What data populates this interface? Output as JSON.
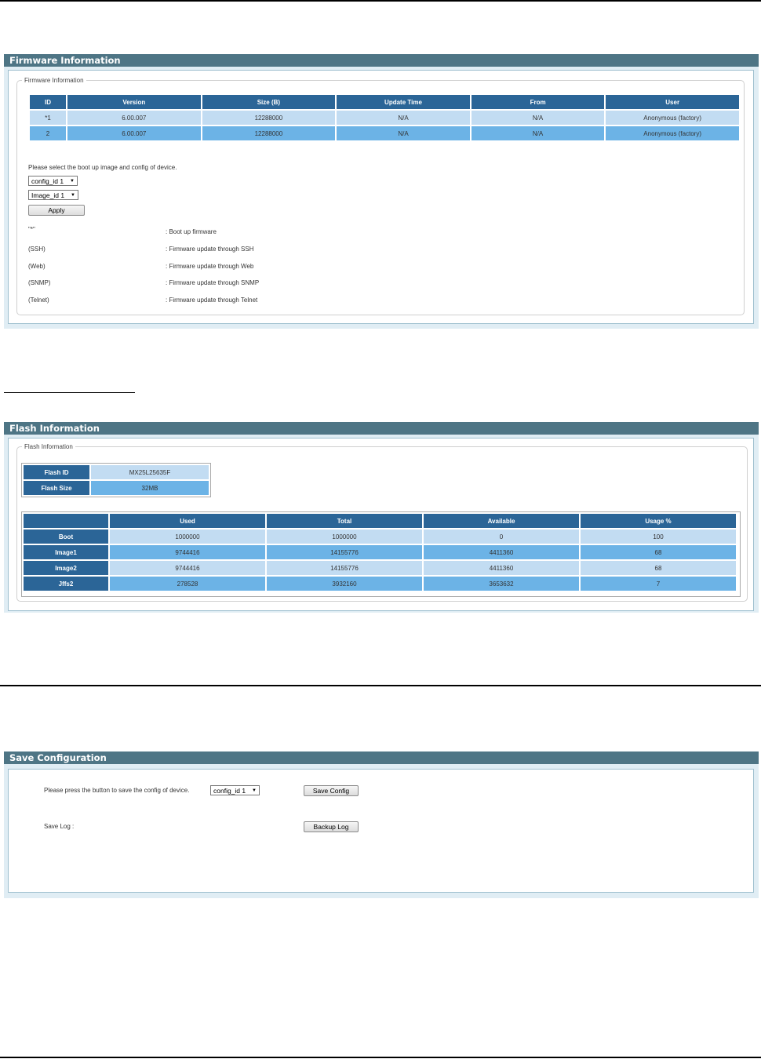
{
  "firmware": {
    "panel_title": "Firmware Information",
    "group_legend": "Firmware Information",
    "columns": [
      "ID",
      "Version",
      "Size (B)",
      "Update Time",
      "From",
      "User"
    ],
    "rows": [
      [
        "*1",
        "6.00.007",
        "12288000",
        "N/A",
        "N/A",
        "Anonymous (factory)"
      ],
      [
        "2",
        "6.00.007",
        "12288000",
        "N/A",
        "N/A",
        "Anonymous (factory)"
      ]
    ],
    "select_prompt": "Please select the boot up image and config of device.",
    "config_select": "config_id 1",
    "image_select": "Image_id 1",
    "apply_label": "Apply",
    "legend_items": [
      {
        "key": "\"*\"",
        "desc": ": Boot up firmware"
      },
      {
        "key": "(SSH)",
        "desc": ": Firmware update through SSH"
      },
      {
        "key": "(Web)",
        "desc": ": Firmware update through Web"
      },
      {
        "key": "(SNMP)",
        "desc": ": Firmware update through SNMP"
      },
      {
        "key": "(Telnet)",
        "desc": ": Firmware update through Telnet"
      }
    ]
  },
  "flash": {
    "panel_title": "Flash Information",
    "group_legend": "Flash Information",
    "flash_id_label": "Flash ID",
    "flash_id_value": "MX25L25635F",
    "flash_size_label": "Flash Size",
    "flash_size_value": "32MB",
    "columns": [
      "",
      "Used",
      "Total",
      "Available",
      "Usage %"
    ],
    "rows": [
      [
        "Boot",
        "1000000",
        "1000000",
        "0",
        "100"
      ],
      [
        "Image1",
        "9744416",
        "14155776",
        "4411360",
        "68"
      ],
      [
        "Image2",
        "9744416",
        "14155776",
        "4411360",
        "68"
      ],
      [
        "Jffs2",
        "278528",
        "3932160",
        "3653632",
        "7"
      ]
    ]
  },
  "save": {
    "panel_title": "Save Configuration",
    "prompt": "Please press the button to save the config of device.",
    "config_select": "config_id 1",
    "save_config_label": "Save Config",
    "log_label": "Save Log :",
    "backup_log_label": "Backup Log"
  }
}
